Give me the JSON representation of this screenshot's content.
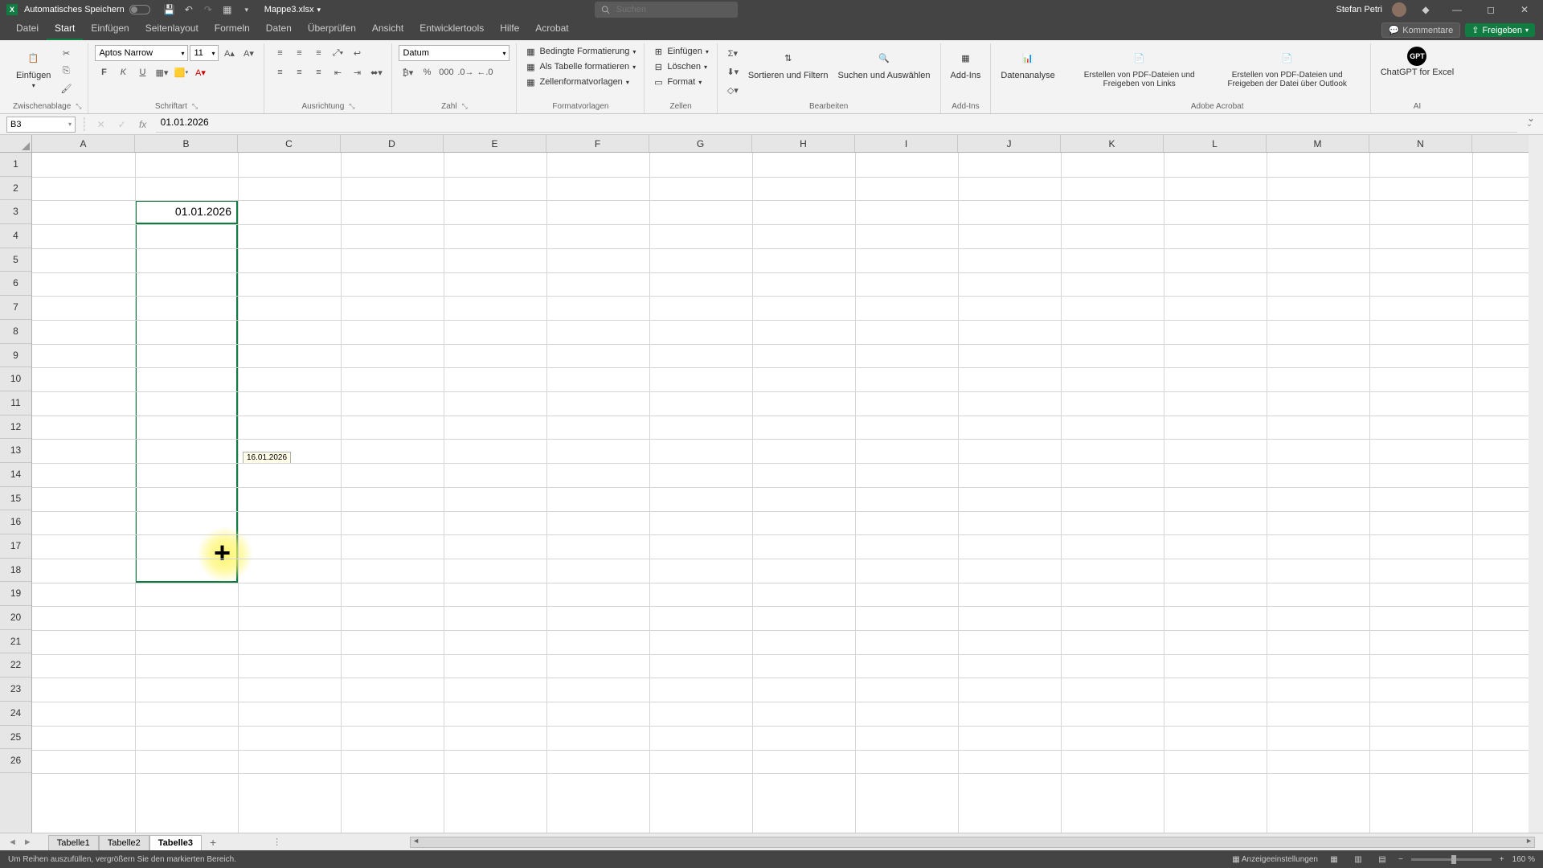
{
  "titlebar": {
    "autosave_label": "Automatisches Speichern",
    "doc_name": "Mappe3.xlsx",
    "search_placeholder": "Suchen",
    "user_name": "Stefan Petri"
  },
  "menu": {
    "tabs": [
      "Datei",
      "Start",
      "Einfügen",
      "Seitenlayout",
      "Formeln",
      "Daten",
      "Überprüfen",
      "Ansicht",
      "Entwicklertools",
      "Hilfe",
      "Acrobat"
    ],
    "active_index": 1,
    "comments": "Kommentare",
    "share": "Freigeben"
  },
  "ribbon": {
    "clipboard": {
      "paste": "Einfügen",
      "group": "Zwischenablage"
    },
    "font": {
      "name": "Aptos Narrow",
      "size": "11",
      "group": "Schriftart"
    },
    "align": {
      "group": "Ausrichtung"
    },
    "number": {
      "format": "Datum",
      "group": "Zahl"
    },
    "styles": {
      "cond": "Bedingte Formatierung",
      "table": "Als Tabelle formatieren",
      "cell": "Zellenformatvorlagen",
      "group": "Formatvorlagen"
    },
    "cells": {
      "insert": "Einfügen",
      "delete": "Löschen",
      "format": "Format",
      "group": "Zellen"
    },
    "editing": {
      "sort": "Sortieren und Filtern",
      "find": "Suchen und Auswählen",
      "group": "Bearbeiten"
    },
    "addins": {
      "addin": "Add-Ins",
      "group": "Add-Ins"
    },
    "data": {
      "analysis": "Datenanalyse"
    },
    "acrobat": {
      "pdf1": "Erstellen von PDF-Dateien und Freigeben von Links",
      "pdf2": "Erstellen von PDF-Dateien und Freigeben der Datei über Outlook",
      "group": "Adobe Acrobat"
    },
    "ai": {
      "gpt": "ChatGPT for Excel",
      "group": "AI"
    }
  },
  "formula": {
    "cell_ref": "B3",
    "value": "01.01.2026"
  },
  "grid": {
    "columns": [
      "A",
      "B",
      "C",
      "D",
      "E",
      "F",
      "G",
      "H",
      "I",
      "J",
      "K",
      "L",
      "M",
      "N"
    ],
    "rows": 26,
    "b3_value": "01.01.2026",
    "fill_tooltip": "16.01.2026"
  },
  "sheets": {
    "tabs": [
      "Tabelle1",
      "Tabelle2",
      "Tabelle3"
    ],
    "active_index": 2
  },
  "status": {
    "msg": "Um Reihen auszufüllen, vergrößern Sie den markierten Bereich.",
    "display": "Anzeigeeinstellungen",
    "zoom": "160 %"
  }
}
